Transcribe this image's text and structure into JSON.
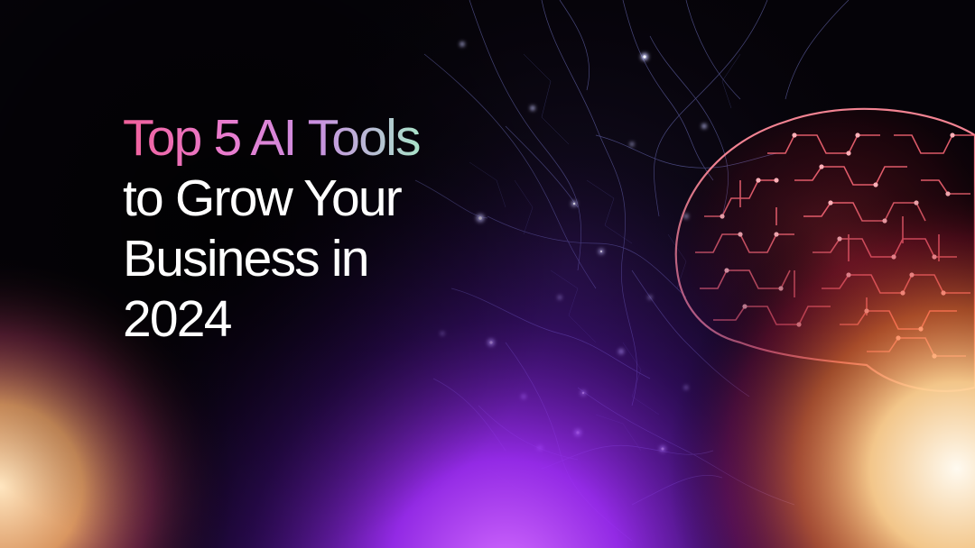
{
  "headline": {
    "line1": "Top 5 AI Tools",
    "line2": "to Grow Your",
    "line3": "Business in",
    "line4": "2024"
  },
  "colors": {
    "background": "#050308",
    "headline_text": "#ffffff",
    "gradient_pink": "#f0609a",
    "gradient_mint": "#a9e3c9",
    "glow_purple": "#9a2cf0",
    "glow_orange": "#ff7a3a",
    "brain_red": "#ff4a5a",
    "neuron_blue": "#8a8cff"
  },
  "icons": {
    "brain": "brain-icon",
    "neurons": "neural-network"
  }
}
